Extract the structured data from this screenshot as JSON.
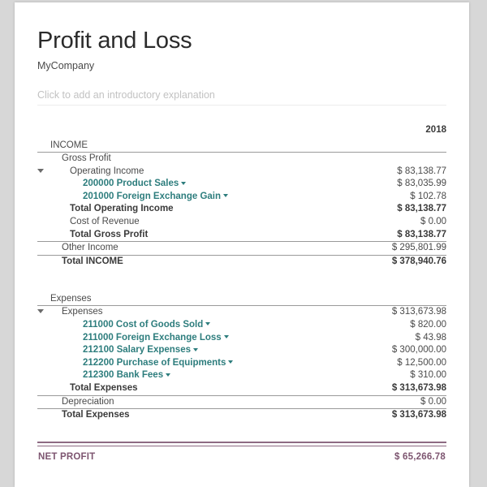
{
  "header": {
    "title": "Profit and Loss",
    "company": "MyCompany",
    "intro_placeholder": "Click to add an introductory explanation"
  },
  "table": {
    "year_column": "2018",
    "income": {
      "section_label": "INCOME",
      "rows": [
        {
          "label": "Gross Profit",
          "amount": "",
          "indent": 1,
          "bold": false,
          "caret": false,
          "link": false
        },
        {
          "label": "Operating Income",
          "amount": "$ 83,138.77",
          "indent": 2,
          "bold": false,
          "caret": true,
          "link": false
        },
        {
          "label": "200000 Product Sales",
          "amount": "$ 83,035.99",
          "indent": 3,
          "bold": false,
          "caret": false,
          "link": true
        },
        {
          "label": "201000 Foreign Exchange Gain",
          "amount": "$ 102.78",
          "indent": 3,
          "bold": false,
          "caret": false,
          "link": true
        },
        {
          "label": "Total Operating Income",
          "amount": "$ 83,138.77",
          "indent": 2,
          "bold": true,
          "caret": false,
          "link": false
        },
        {
          "label": "Cost of Revenue",
          "amount": "$ 0.00",
          "indent": 2,
          "bold": false,
          "caret": false,
          "link": false
        },
        {
          "label": "Total Gross Profit",
          "amount": "$ 83,138.77",
          "indent": 2,
          "bold": true,
          "caret": false,
          "link": false
        },
        {
          "label": "Other Income",
          "amount": "$ 295,801.99",
          "indent": 1,
          "bold": false,
          "caret": false,
          "link": false
        },
        {
          "label": "Total INCOME",
          "amount": "$ 378,940.76",
          "indent": 1,
          "bold": true,
          "caret": false,
          "link": false
        }
      ]
    },
    "expenses": {
      "section_label": "Expenses",
      "rows": [
        {
          "label": "Expenses",
          "amount": "$ 313,673.98",
          "indent": 1,
          "bold": false,
          "caret": true,
          "link": false
        },
        {
          "label": "211000 Cost of Goods Sold",
          "amount": "$ 820.00",
          "indent": 3,
          "bold": false,
          "caret": false,
          "link": true
        },
        {
          "label": "211000 Foreign Exchange Loss",
          "amount": "$ 43.98",
          "indent": 3,
          "bold": false,
          "caret": false,
          "link": true
        },
        {
          "label": "212100 Salary Expenses",
          "amount": "$ 300,000.00",
          "indent": 3,
          "bold": false,
          "caret": false,
          "link": true
        },
        {
          "label": "212200 Purchase of Equipments",
          "amount": "$ 12,500.00",
          "indent": 3,
          "bold": false,
          "caret": false,
          "link": true
        },
        {
          "label": "212300 Bank Fees",
          "amount": "$ 310.00",
          "indent": 3,
          "bold": false,
          "caret": false,
          "link": true
        },
        {
          "label": "Total Expenses",
          "amount": "$ 313,673.98",
          "indent": 2,
          "bold": true,
          "caret": false,
          "link": false
        },
        {
          "label": "Depreciation",
          "amount": "$ 0.00",
          "indent": 1,
          "bold": false,
          "caret": false,
          "link": false
        },
        {
          "label": "Total Expenses",
          "amount": "$ 313,673.98",
          "indent": 1,
          "bold": true,
          "caret": false,
          "link": false
        }
      ]
    },
    "net_profit": {
      "label": "NET PROFIT",
      "amount": "$ 65,266.78"
    }
  },
  "colors": {
    "account_link": "#2d7d7d",
    "net_profit": "#7d5570",
    "net_profit_rule": "#8d6a82",
    "text": "#4a4a4a"
  }
}
